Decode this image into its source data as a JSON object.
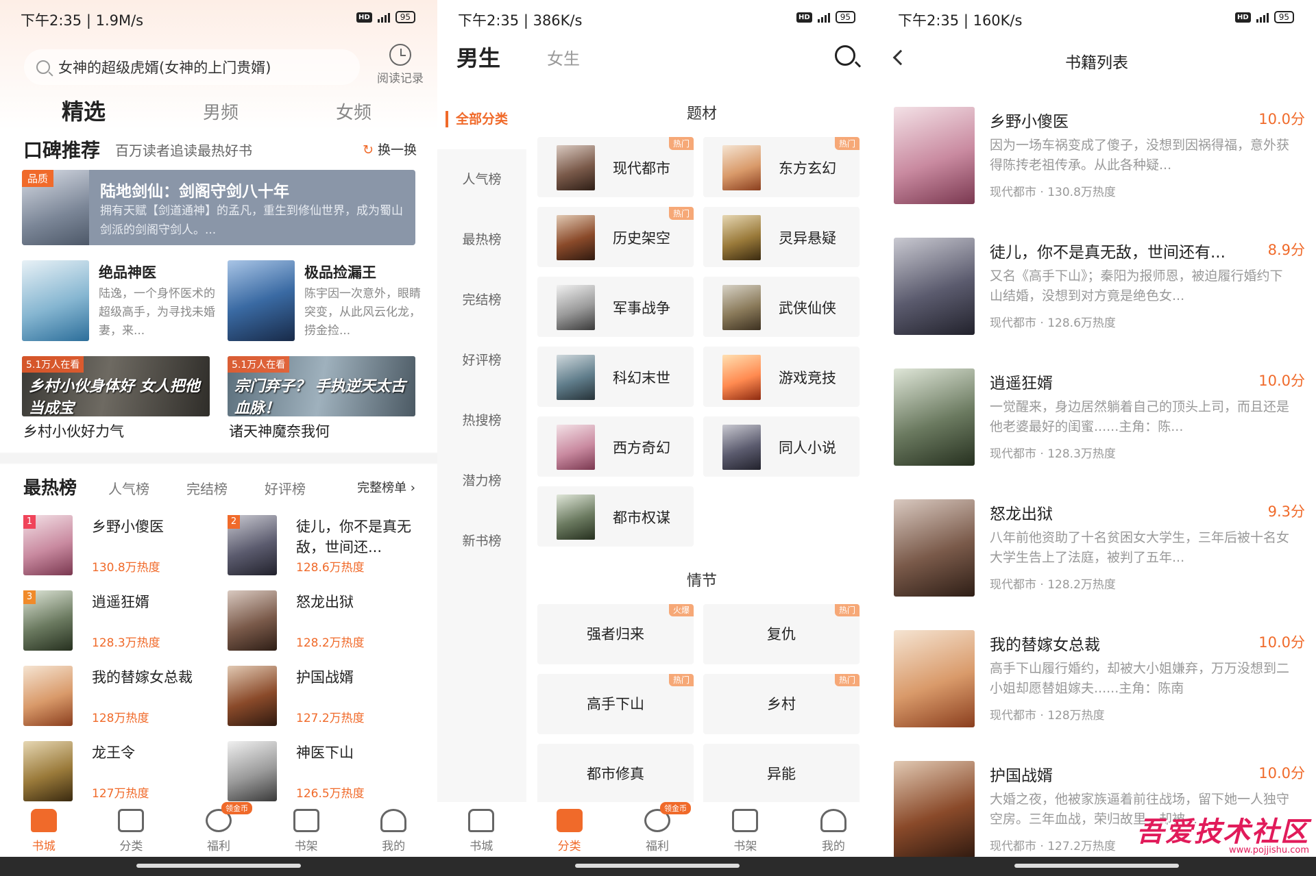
{
  "colors": {
    "accent": "#f06a2a",
    "hot_tag": "#f6a877",
    "watermark": "#e11b5a"
  },
  "panel1": {
    "status": {
      "time": "下午2:35 | 1.9M/s",
      "battery": "95"
    },
    "search": {
      "query": "女神的超级虎婿(女神的上门贵婿)"
    },
    "history_label": "阅读记录",
    "tabs": [
      "精选",
      "男频",
      "女频"
    ],
    "section": {
      "title": "口碑推荐",
      "subtitle": "百万读者追读最热好书",
      "swap": "换一换"
    },
    "hero": {
      "tag": "品质",
      "title": "陆地剑仙：剑阁守剑八十年",
      "desc": "拥有天赋【剑道通神】的孟凡，重生到修仙世界，成为蜀山剑派的剑阁守剑人。..."
    },
    "cards": [
      {
        "title": "绝品神医",
        "desc": "陆逸，一个身怀医术的超级高手，为寻找未婚妻，来..."
      },
      {
        "title": "极品捡漏王",
        "desc": "陈宇因一次意外，眼睛突变，从此风云化龙，捞金捡..."
      }
    ],
    "banners": [
      {
        "tag": "5.1万人在看",
        "art": "乡村小伙身体好 女人把他当成宝",
        "caption": "乡村小伙好力气"
      },
      {
        "tag": "5.1万人在看",
        "art": "宗门弃子？ 手执逆天太古血脉！",
        "caption": "诸天神魔奈我何"
      }
    ],
    "rank": {
      "title": "最热榜",
      "tabs": [
        "人气榜",
        "完结榜",
        "好评榜"
      ],
      "full": "完整榜单 ›"
    },
    "rank_items": [
      {
        "rank": "1",
        "title": "乡野小傻医",
        "heat": "130.8万热度"
      },
      {
        "rank": "2",
        "title": "徒儿，你不是真无敌，世间还...",
        "heat": "128.6万热度"
      },
      {
        "rank": "3",
        "title": "逍遥狂婿",
        "heat": "128.3万热度"
      },
      {
        "rank": "",
        "title": "怒龙出狱",
        "heat": "128.2万热度"
      },
      {
        "rank": "",
        "title": "我的替嫁女总裁",
        "heat": "128万热度"
      },
      {
        "rank": "",
        "title": "护国战婿",
        "heat": "127.2万热度"
      },
      {
        "rank": "",
        "title": "龙王令",
        "heat": "127万热度"
      },
      {
        "rank": "",
        "title": "神医下山",
        "heat": "126.5万热度"
      }
    ],
    "nav": [
      {
        "label": "书城",
        "icon": "home-icon"
      },
      {
        "label": "分类",
        "icon": "grid-icon"
      },
      {
        "label": "福利",
        "icon": "coin-icon",
        "badge": "领金币"
      },
      {
        "label": "书架",
        "icon": "shelf-icon"
      },
      {
        "label": "我的",
        "icon": "user-icon"
      }
    ]
  },
  "panel2": {
    "status": {
      "time": "下午2:35 | 386K/s",
      "battery": "95"
    },
    "gender_tabs": [
      "男生",
      "女生"
    ],
    "sidebar": [
      "全部分类",
      "人气榜",
      "最热榜",
      "完结榜",
      "好评榜",
      "热搜榜",
      "潜力榜",
      "新书榜"
    ],
    "group1": "题材",
    "categories": [
      {
        "name": "现代都市",
        "hot": "热门"
      },
      {
        "name": "东方玄幻",
        "hot": "热门"
      },
      {
        "name": "历史架空",
        "hot": "热门"
      },
      {
        "name": "灵异悬疑",
        "hot": ""
      },
      {
        "name": "军事战争",
        "hot": ""
      },
      {
        "name": "武侠仙侠",
        "hot": ""
      },
      {
        "name": "科幻末世",
        "hot": ""
      },
      {
        "name": "游戏竞技",
        "hot": ""
      },
      {
        "name": "西方奇幻",
        "hot": ""
      },
      {
        "name": "同人小说",
        "hot": ""
      },
      {
        "name": "都市权谋",
        "hot": ""
      }
    ],
    "group2": "情节",
    "plots": [
      {
        "name": "强者归来",
        "hot": "火爆"
      },
      {
        "name": "复仇",
        "hot": "热门"
      },
      {
        "name": "高手下山",
        "hot": "热门"
      },
      {
        "name": "乡村",
        "hot": "热门"
      },
      {
        "name": "都市修真",
        "hot": ""
      },
      {
        "name": "异能",
        "hot": ""
      }
    ],
    "nav": [
      {
        "label": "书城"
      },
      {
        "label": "分类"
      },
      {
        "label": "福利",
        "badge": "领金币"
      },
      {
        "label": "书架"
      },
      {
        "label": "我的"
      }
    ]
  },
  "panel3": {
    "status": {
      "time": "下午2:35 | 160K/s",
      "battery": "95"
    },
    "title": "书籍列表",
    "books": [
      {
        "title": "乡野小傻医",
        "score": "10.0分",
        "desc": "因为一场车祸变成了傻子，没想到因祸得福，意外获得陈抟老祖传承。从此各种疑...",
        "meta": "现代都市 · 130.8万热度"
      },
      {
        "title": "徒儿，你不是真无敌，世间还有...",
        "score": "8.9分",
        "desc": "又名《高手下山》；秦阳为报师恩，被迫履行婚约下山结婚，没想到对方竟是绝色女...",
        "meta": "现代都市 · 128.6万热度"
      },
      {
        "title": "逍遥狂婿",
        "score": "10.0分",
        "desc": "一觉醒来，身边居然躺着自己的顶头上司，而且还是他老婆最好的闺蜜......主角：陈...",
        "meta": "现代都市 · 128.3万热度"
      },
      {
        "title": "怒龙出狱",
        "score": "9.3分",
        "desc": "八年前他资助了十名贫困女大学生，三年后被十名女大学生告上了法庭，被判了五年...",
        "meta": "现代都市 · 128.2万热度"
      },
      {
        "title": "我的替嫁女总裁",
        "score": "10.0分",
        "desc": "高手下山履行婚约，却被大小姐嫌弃，万万没想到二小姐却愿替姐嫁夫......主角：陈南",
        "meta": "现代都市 · 128万热度"
      },
      {
        "title": "护国战婿",
        "score": "10.0分",
        "desc": "大婚之夜，他被家族逼着前往战场，留下她一人独守空房。三年血战，荣归故里，却被...",
        "meta": "现代都市 · 127.2万热度"
      }
    ],
    "watermark": {
      "main": "吾爱技术社区",
      "url": "www.pojjishu.com"
    }
  }
}
